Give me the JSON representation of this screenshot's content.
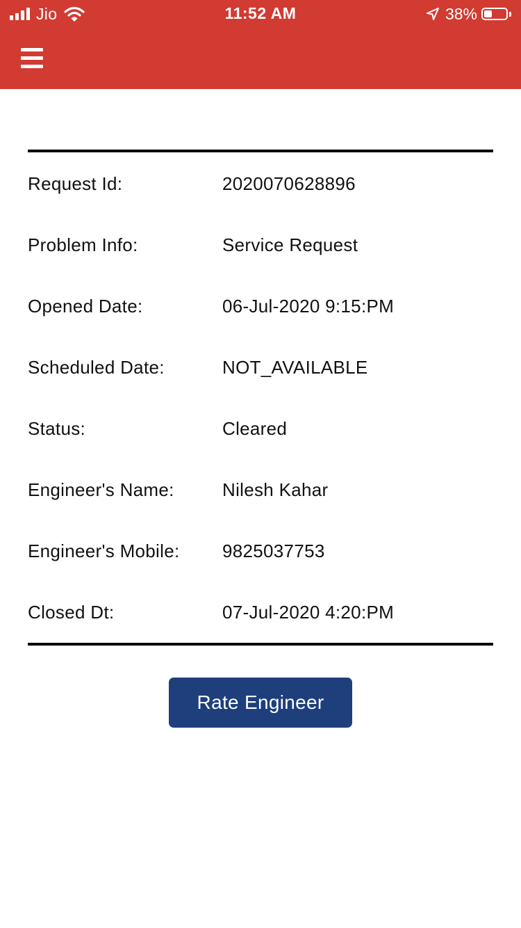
{
  "status_bar": {
    "carrier": "Jio",
    "time": "11:52 AM",
    "battery_percent": "38%",
    "battery_level": 0.38,
    "icons": [
      "signal-icon",
      "wifi-icon",
      "location-arrow-icon",
      "battery-icon"
    ]
  },
  "header": {
    "menu_icon": "hamburger-menu-icon",
    "color": "#d13b32"
  },
  "details": [
    {
      "label": "Request Id:",
      "value": "2020070628896"
    },
    {
      "label": "Problem Info:",
      "value": "Service Request"
    },
    {
      "label": "Opened Date:",
      "value": "06-Jul-2020 9:15:PM"
    },
    {
      "label": "Scheduled Date:",
      "value": "NOT_AVAILABLE"
    },
    {
      "label": "Status:",
      "value": "Cleared"
    },
    {
      "label": "Engineer's Name:",
      "value": "Nilesh Kahar"
    },
    {
      "label": "Engineer's Mobile:",
      "value": "9825037753"
    },
    {
      "label": "Closed Dt:",
      "value": "07-Jul-2020 4:20:PM"
    }
  ],
  "actions": {
    "rate_label": "Rate Engineer",
    "button_color": "#1e3f7c"
  }
}
